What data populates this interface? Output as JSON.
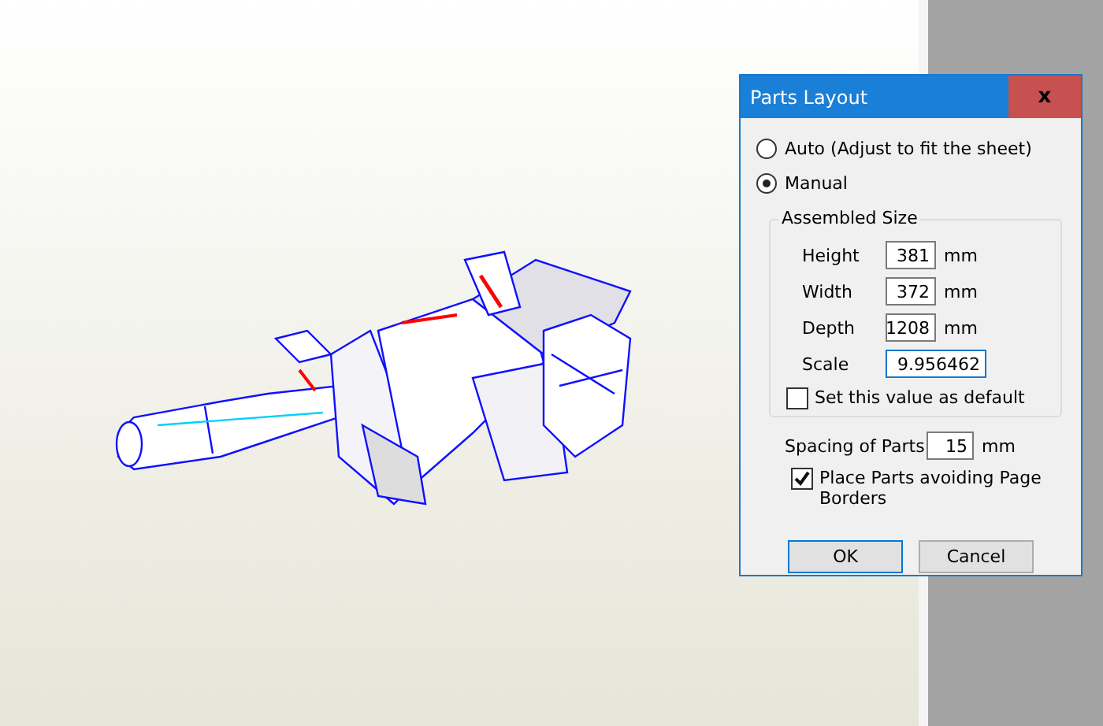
{
  "dialog": {
    "title": "Parts Layout",
    "close": "x",
    "modes": [
      {
        "label": "Auto (Adjust to fit the sheet)",
        "selected": false
      },
      {
        "label": "Manual",
        "selected": true
      }
    ],
    "assembled_size": {
      "title": "Assembled Size",
      "fields": [
        {
          "label": "Height",
          "value": "381",
          "unit": "mm",
          "kind": "short"
        },
        {
          "label": "Width",
          "value": "372",
          "unit": "mm",
          "kind": "short"
        },
        {
          "label": "Depth",
          "value": "1208",
          "unit": "mm",
          "kind": "short"
        },
        {
          "label": "Scale",
          "value": "9.956462",
          "kind": "long"
        }
      ],
      "default_checkbox": {
        "label": "Set this value as default",
        "checked": false
      }
    },
    "spacing": {
      "label": "Spacing of Parts",
      "value": "15",
      "unit": "mm"
    },
    "avoid_borders": {
      "label": "Place Parts avoiding Page Borders",
      "checked": true
    },
    "buttons": [
      "OK",
      "Cancel"
    ]
  }
}
